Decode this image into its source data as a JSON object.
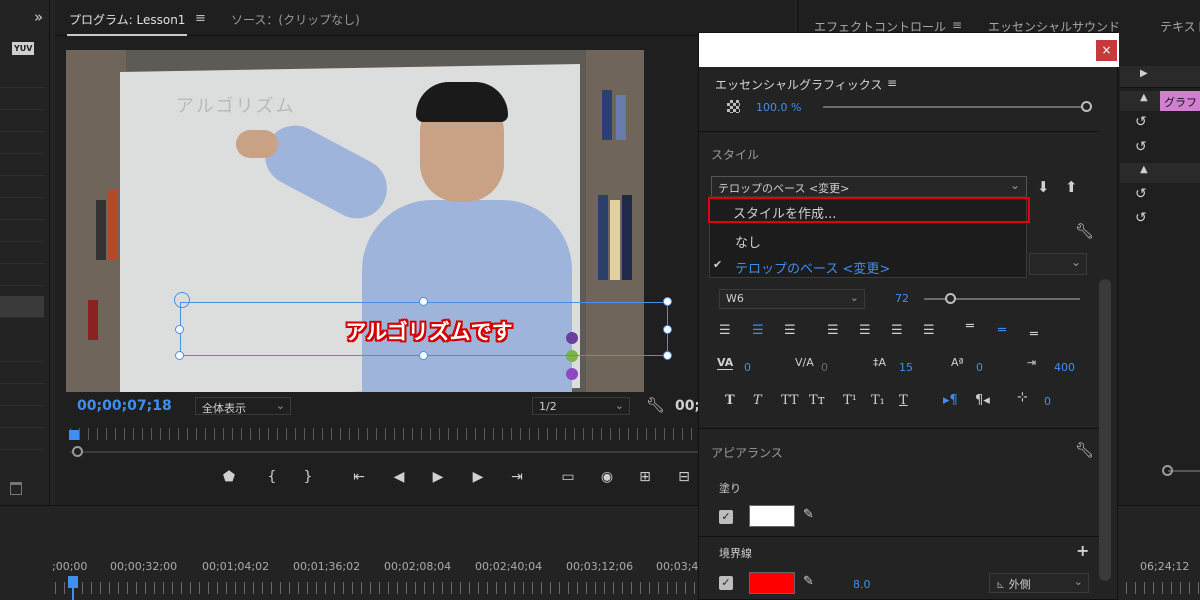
{
  "program_monitor": {
    "tab_program": "プログラム: Lesson1",
    "tab_source": "ソース：(クリップなし)",
    "timecode": "00;00;07;18",
    "zoom_select": "全体表示",
    "resolution_select": "1/2",
    "right_timecode_partial": "00;",
    "whiteboard_text": "アルゴリズム",
    "caption_text": "アルゴリズムです",
    "transport_icons": [
      "marker-icon",
      "in-point-icon",
      "out-point-icon",
      "go-to-in-icon",
      "step-back-icon",
      "play-icon",
      "step-forward-icon",
      "go-to-out-icon",
      "safe-margins-icon",
      "export-frame-icon",
      "lift-icon",
      "extract-icon"
    ]
  },
  "left_strip": {
    "toggle_icon": "»",
    "yuv_label": "YUV",
    "trash_icon": "trash-icon"
  },
  "right_panel": {
    "tab_effect_controls": "エフェクトコントロール",
    "tab_essential_sound": "エッセンシャルサウンド",
    "tab_text_partial": "テキスト",
    "clip_label": "グラフ"
  },
  "dialog": {
    "close_label": "×",
    "title": "エッセンシャルグラフィックス",
    "opacity_value": "100.0 %",
    "opacity_level": 1.0,
    "style_section": "スタイル",
    "style_selected": "テロップのベース <変更>",
    "dropdown_items": [
      {
        "label": "スタイルを作成...",
        "checked": false
      },
      {
        "label": "なし",
        "checked": false
      },
      {
        "label": "テロップのベース <変更>",
        "checked": true
      }
    ],
    "font_weight": "W6",
    "font_size": "72",
    "font_size_level": 0.15,
    "tracking_values": {
      "kerning": "0",
      "tracking": "0",
      "leading": "15",
      "baseline": "0",
      "tsume": "400",
      "tab_width": "0"
    },
    "appearance_section": "アピアランス",
    "fill_label": "塗り",
    "fill_color": "#ffffff",
    "stroke_label": "境界線",
    "stroke_color": "#ff0000",
    "stroke_width": "8.0",
    "stroke_position": "外側",
    "accent_color": "#3f8ff0"
  },
  "timeline": {
    "ruler_labels": [
      ";00;00",
      "00;00;32;00",
      "00;01;04;02",
      "00;01;36;02",
      "00;02;08;04",
      "00;02;40;04",
      "00;03;12;06",
      "00;03;4",
      "06;24;12"
    ]
  }
}
